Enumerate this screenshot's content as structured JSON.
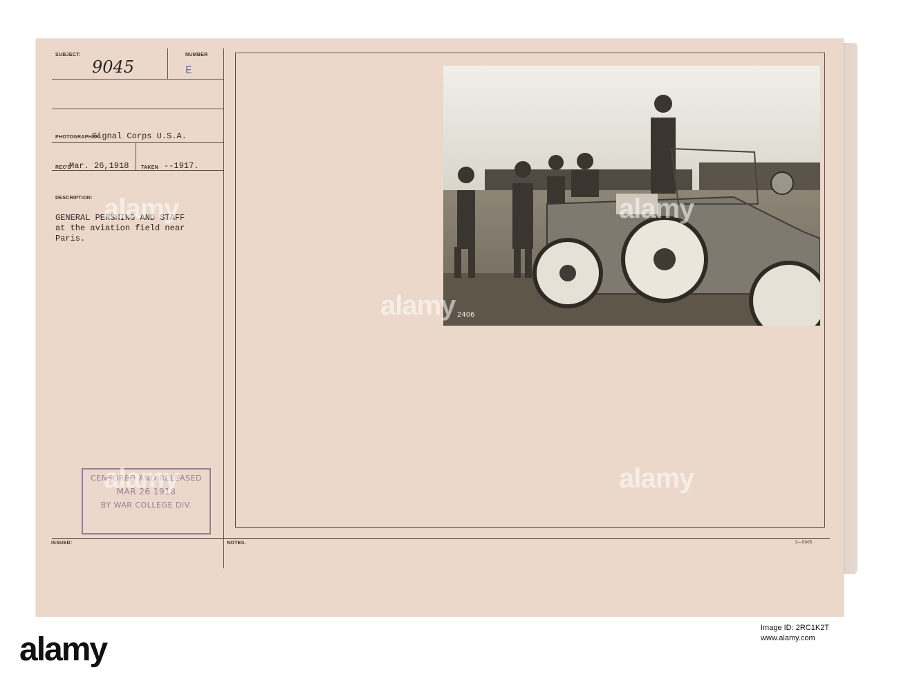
{
  "card": {
    "subject_label": "SUBJECT:",
    "subject_number": "9045",
    "number_label": "NUMBER",
    "number_value": "E",
    "photographer_label": "PHOTOGRAPHER",
    "photographer_value": "Signal Corps U.S.A.",
    "recd_label": "REC'D",
    "recd_value": "Mar. 26,1918",
    "taken_label": "TAKEN",
    "taken_value": "--1917.",
    "description_label": "DESCRIPTION:",
    "description_line1": "GENERAL PERSHING AND STAFF",
    "description_line2": "at the aviation field near",
    "description_line3": "Paris.",
    "issued_label": "ISSUED:",
    "notes_label": "NOTES.",
    "form_code": "3—5005"
  },
  "stamp": {
    "line1": "CENSORED AND RELEASED",
    "line2": "MAR 26 1918",
    "line3": "BY WAR COLLEGE DIV."
  },
  "photo": {
    "negative_number": "2406"
  },
  "watermark": {
    "text": "alamy"
  },
  "footer": {
    "logo_text": "alamy",
    "image_id": "Image ID: 2RC1K2T",
    "url": "www.alamy.com"
  }
}
